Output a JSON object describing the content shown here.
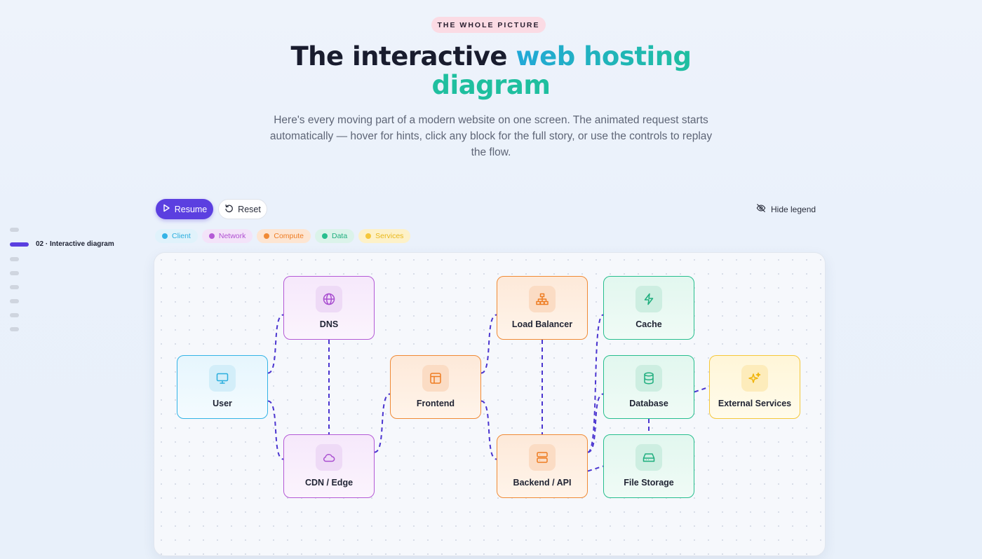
{
  "header": {
    "badge": "THE WHOLE PICTURE",
    "title_plain": "The interactive ",
    "title_highlight": "web hosting",
    "title_highlight2": "diagram",
    "subtitle": "Here's every moving part of a modern website on one screen. The animated request starts automatically — hover for hints, click any block for the full story, or use the controls to replay the flow."
  },
  "sidenav": {
    "active_label": "02 · Interactive diagram"
  },
  "controls": {
    "resume_label": "Resume",
    "reset_label": "Reset",
    "hide_legend_label": "Hide legend"
  },
  "legend": [
    {
      "label": "Client",
      "color": "#33b3e6",
      "bg": "#e0f2fb",
      "text": "#2aaede"
    },
    {
      "label": "Network",
      "color": "#b45ad6",
      "bg": "#f3e3f9",
      "text": "#b04fd2"
    },
    {
      "label": "Compute",
      "color": "#f08a35",
      "bg": "#fde5d2",
      "text": "#ee7c22"
    },
    {
      "label": "Data",
      "color": "#27be8e",
      "bg": "#dbf3ea",
      "text": "#1fae7e"
    },
    {
      "label": "Services",
      "color": "#f5c73a",
      "bg": "#fdf1c8",
      "text": "#e9b81a"
    }
  ],
  "nodes": {
    "user": {
      "label": "User",
      "icon": "monitor-icon"
    },
    "dns": {
      "label": "DNS",
      "icon": "globe-icon"
    },
    "cdn": {
      "label": "CDN / Edge",
      "icon": "cloud-icon"
    },
    "frontend": {
      "label": "Frontend",
      "icon": "layout-icon"
    },
    "lb": {
      "label": "Load Balancer",
      "icon": "network-icon"
    },
    "backend": {
      "label": "Backend / API",
      "icon": "server-icon"
    },
    "cache": {
      "label": "Cache",
      "icon": "bolt-icon"
    },
    "database": {
      "label": "Database",
      "icon": "database-icon"
    },
    "storage": {
      "label": "File Storage",
      "icon": "hard-drive-icon"
    },
    "external": {
      "label": "External Services",
      "icon": "sparkles-icon"
    }
  },
  "edges": [
    [
      "user",
      "dns"
    ],
    [
      "user",
      "cdn"
    ],
    [
      "dns",
      "cdn"
    ],
    [
      "cdn",
      "frontend"
    ],
    [
      "frontend",
      "lb"
    ],
    [
      "frontend",
      "backend"
    ],
    [
      "lb",
      "backend"
    ],
    [
      "backend",
      "cache"
    ],
    [
      "backend",
      "database"
    ],
    [
      "backend",
      "storage"
    ],
    [
      "database",
      "storage"
    ],
    [
      "database",
      "external"
    ]
  ],
  "colors": {
    "accent": "#5b3fe0",
    "edge": "#4b35d0"
  }
}
